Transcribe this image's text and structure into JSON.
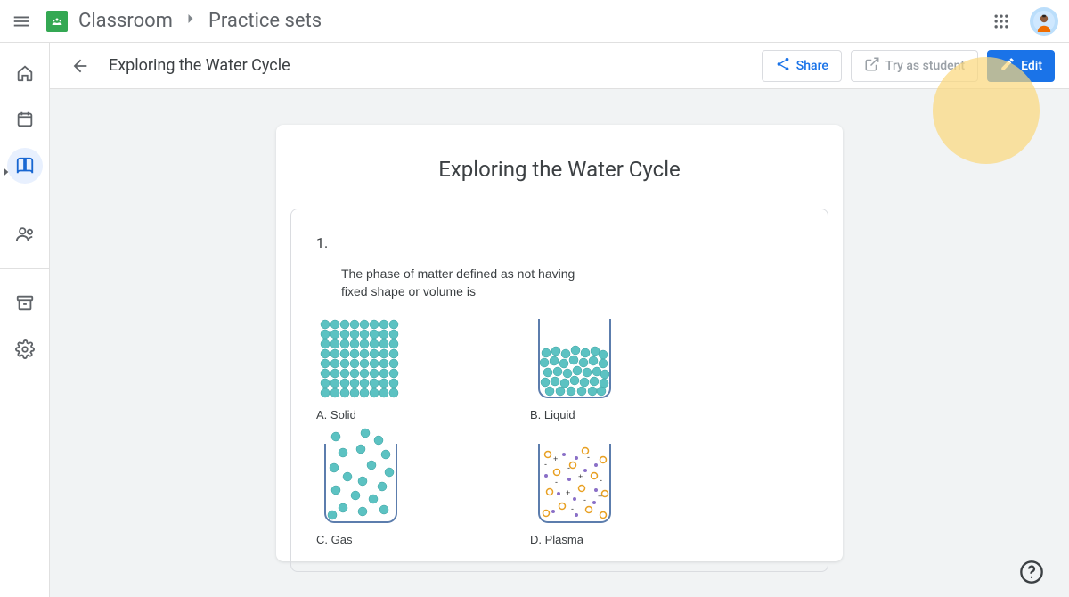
{
  "app": {
    "name": "Classroom",
    "subpage": "Practice sets"
  },
  "page": {
    "title": "Exploring the Water Cycle"
  },
  "actions": {
    "share": "Share",
    "try_as_student": "Try as student",
    "edit": "Edit"
  },
  "document": {
    "title": "Exploring the Water Cycle",
    "question": {
      "number": "1.",
      "text": "The phase of matter defined as not having fixed shape or volume is",
      "options": {
        "a": "A. Solid",
        "b": "B. Liquid",
        "c": "C. Gas",
        "d": "D. Plasma"
      }
    }
  }
}
